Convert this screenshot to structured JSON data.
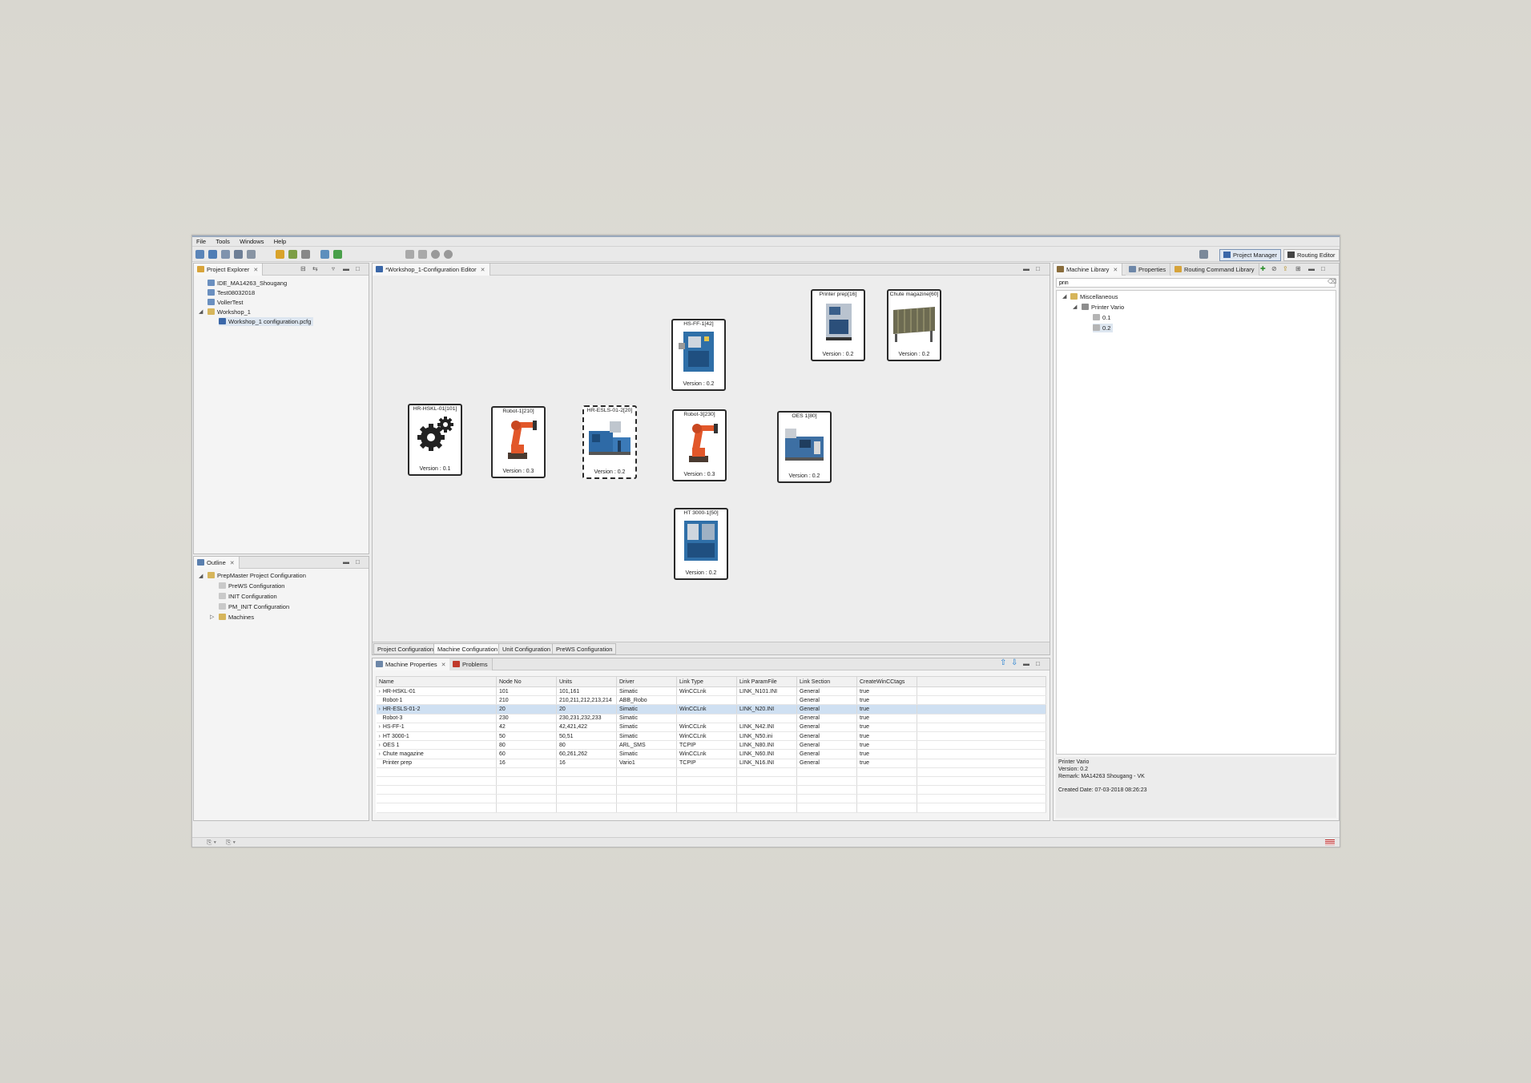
{
  "menu": [
    "File",
    "Tools",
    "Windows",
    "Help"
  ],
  "perspectives": {
    "project_manager": "Project Manager",
    "routing_editor": "Routing Editor"
  },
  "project_explorer": {
    "tab": "Project Explorer",
    "items": [
      {
        "label": "IDE_MA14263_Shougang",
        "icon": "folder-icon"
      },
      {
        "label": "Test08032018",
        "icon": "folder-icon"
      },
      {
        "label": "VollerTest",
        "icon": "folder-icon"
      },
      {
        "label": "Workshop_1",
        "icon": "folder-icon"
      },
      {
        "label": "Workshop_1 configuration.pcfg",
        "icon": "config-file-icon"
      }
    ]
  },
  "outline": {
    "tab": "Outline",
    "items": [
      "PrepMaster Project Configuration",
      "PreWS Configuration",
      "INIT Configuration",
      "PM_INIT Configuration",
      "Machines"
    ]
  },
  "editor": {
    "tab": "*Workshop_1-Configuration Editor",
    "machines": [
      {
        "title": "HR-HSKL-01[101]",
        "version": "Version : 0.1",
        "kind": "gears"
      },
      {
        "title": "Robot-1[210]",
        "version": "Version : 0.3",
        "kind": "robot"
      },
      {
        "title": "HR-ESLS-01-2[20]",
        "version": "Version : 0.2",
        "kind": "press"
      },
      {
        "title": "Robot-3[230]",
        "version": "Version : 0.3",
        "kind": "robot"
      },
      {
        "title": "OES 1[80]",
        "version": "Version : 0.2",
        "kind": "spectrometer"
      },
      {
        "title": "HS-FF-1[42]",
        "version": "Version : 0.2",
        "kind": "cabinet"
      },
      {
        "title": "Printer prep[16]",
        "version": "Version : 0.2",
        "kind": "printer"
      },
      {
        "title": "Chute magazine[60]",
        "version": "Version : 0.2",
        "kind": "chute"
      },
      {
        "title": "HT 3000-1[50]",
        "version": "Version : 0.2",
        "kind": "cabinet"
      }
    ],
    "bottom_tabs": [
      "Project Configuration",
      "Machine Configuration",
      "Unit Configuration",
      "PreWS Configuration"
    ]
  },
  "properties": {
    "tabs": [
      "Machine Properties",
      "Problems"
    ],
    "columns": [
      "Name",
      "Node No",
      "Units",
      "Driver",
      "Link Type",
      "Link ParamFile",
      "Link Section",
      "CreateWinCCtags"
    ],
    "rows": [
      [
        "HR-HSKL-01",
        "101",
        "101,161",
        "Simatic",
        "WinCCLnk",
        "LINK_N101.INI",
        "General",
        "true"
      ],
      [
        "Robot-1",
        "210",
        "210,211,212,213,214",
        "ABB_Robo",
        "",
        "",
        "General",
        "true"
      ],
      [
        "HR-ESLS-01-2",
        "20",
        "20",
        "Simatic",
        "WinCCLnk",
        "LINK_N20.INI",
        "General",
        "true"
      ],
      [
        "Robot-3",
        "230",
        "230,231,232,233",
        "Simatic",
        "",
        "",
        "General",
        "true"
      ],
      [
        "HS-FF-1",
        "42",
        "42,421,422",
        "Simatic",
        "WinCCLnk",
        "LINK_N42.INI",
        "General",
        "true"
      ],
      [
        "HT 3000-1",
        "50",
        "50,51",
        "Simatic",
        "WinCCLnk",
        "LINK_N50.ini",
        "General",
        "true"
      ],
      [
        "OES 1",
        "80",
        "80",
        "ARL_SMS",
        "TCPIP",
        "LINK_N80.INI",
        "General",
        "true"
      ],
      [
        "Chute magazine",
        "60",
        "60,261,262",
        "Simatic",
        "WinCCLnk",
        "LINK_N60.INI",
        "General",
        "true"
      ],
      [
        "Printer prep",
        "16",
        "16",
        "Vario1",
        "TCPIP",
        "LINK_N16.INI",
        "General",
        "true"
      ]
    ]
  },
  "library": {
    "tabs": [
      "Machine Library",
      "Properties",
      "Routing Command Library"
    ],
    "filter_value": "prin",
    "tree": [
      "Miscellaneous",
      "Printer Vario",
      "0.1",
      "0.2"
    ],
    "details": {
      "name": "Printer Vario",
      "version": "Version: 0.2",
      "remark": "Remark: MA14263 Shougang - VK",
      "created": "Created Date: 07-03-2018 08:26:23"
    }
  }
}
